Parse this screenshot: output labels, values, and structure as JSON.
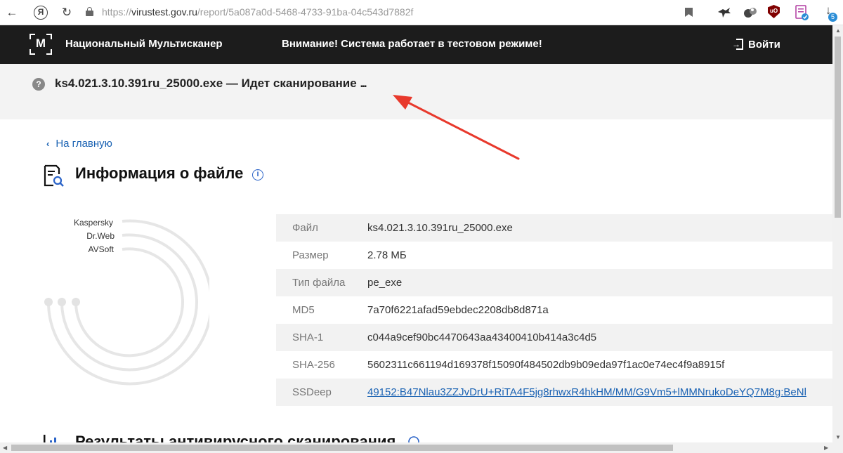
{
  "browser": {
    "url_prefix": "https://",
    "url_domain": "virustest.gov.ru",
    "url_path": "/report/5a087a0d-5468-4733-91ba-04c543d7882f",
    "yandex_label": "Я",
    "ublock_label": "uO",
    "downloads_count": "5"
  },
  "header": {
    "site_name": "Национальный Мультисканер",
    "logo_letter": "М",
    "warning": "Внимание! Система работает в тестовом режиме!",
    "login_label": "Войти"
  },
  "status": {
    "filename": "ks4.021.3.10.391ru_25000.exe",
    "separator": "—",
    "message": "Идет сканирование",
    "dots": "..."
  },
  "content": {
    "back_link": "На главную",
    "page_title": "Информация о файле",
    "engines": [
      "Kaspersky",
      "Dr.Web",
      "AVSoft"
    ],
    "file_info": [
      {
        "key": "Файл",
        "value": "ks4.021.3.10.391ru_25000.exe"
      },
      {
        "key": "Размер",
        "value": "2.78 МБ"
      },
      {
        "key": "Тип файла",
        "value": "pe_exe"
      },
      {
        "key": "MD5",
        "value": "7a70f6221afad59ebdec2208db8d871a"
      },
      {
        "key": "SHA-1",
        "value": "c044a9cef90bc4470643aa43400410b414a3c4d5"
      },
      {
        "key": "SHA-256",
        "value": "5602311c661194d169378f15090f484502db9b09eda97f1ac0e74ec4f9a8915f"
      },
      {
        "key": "SSDeep",
        "value": "49152:B47Nlau3ZZJvDrU+RiTA4F5jg8rhwxR4hkHM/MM/G9Vm5+lMMNrukoDeYQ7M8g:BeNl"
      }
    ],
    "results_title": "Результаты антивирусного сканирования"
  },
  "colors": {
    "header_bg": "#1c1c1c",
    "status_bg": "#f3f3f3",
    "link": "#1a62b3",
    "annotation_arrow": "#e8392c"
  }
}
